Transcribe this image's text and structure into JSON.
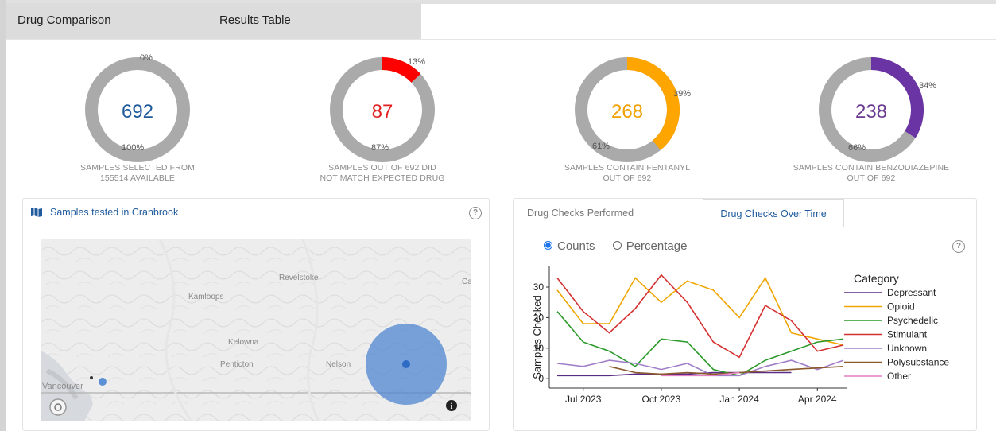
{
  "tabs": {
    "drug_comparison": "Drug Comparison",
    "results_table": "Results Table"
  },
  "donuts": [
    {
      "value": "692",
      "percent": 0,
      "top_label": "0%",
      "bottom_label": "100%",
      "caption1": "SAMPLES SELECTED FROM",
      "caption2": "155514 AVAILABLE",
      "color": "#1f5a9d",
      "slice": "#1f5a9d"
    },
    {
      "value": "87",
      "percent": 13,
      "top_label": "13%",
      "bottom_label": "87%",
      "caption1": "SAMPLES OUT OF 692 DID",
      "caption2": "NOT MATCH EXPECTED DRUG",
      "color": "#e02020",
      "slice": "#ff0000"
    },
    {
      "value": "268",
      "percent": 39,
      "top_label": "39%",
      "bottom_label": "61%",
      "caption1": "SAMPLES CONTAIN FENTANYL",
      "caption2": "OUT OF 692",
      "color": "#f0a000",
      "slice": "#ffa500"
    },
    {
      "value": "238",
      "percent": 34,
      "top_label": "34%",
      "bottom_label": "66%",
      "caption1": "SAMPLES CONTAIN BENZODIAZEPINE",
      "caption2": "OUT OF 692",
      "color": "#6a3a90",
      "slice": "#6a34a4"
    }
  ],
  "map": {
    "title": "Samples tested in Cranbrook",
    "help": "?",
    "info": "i",
    "places": [
      "Revelstoke",
      "Kamloops",
      "Kelowna",
      "Penticton",
      "Nelson",
      "Vancouver",
      "Ca"
    ]
  },
  "chart_panel": {
    "tab_performed": "Drug Checks Performed",
    "tab_over_time": "Drug Checks Over Time",
    "radio_counts": "Counts",
    "radio_percentage": "Percentage",
    "help": "?"
  },
  "chart_data": {
    "type": "line",
    "ylabel": "Samples Checked",
    "xlabel": "",
    "x": [
      "2023-06",
      "2023-07",
      "2023-08",
      "2023-09",
      "2023-10",
      "2023-11",
      "2023-12",
      "2024-01",
      "2024-02",
      "2024-03",
      "2024-04",
      "2024-05"
    ],
    "xticks": [
      {
        "label": "Jul 2023",
        "i": 1
      },
      {
        "label": "Oct 2023",
        "i": 4
      },
      {
        "label": "Jan 2024",
        "i": 7
      },
      {
        "label": "Apr 2024",
        "i": 10
      }
    ],
    "yticks": [
      0,
      10,
      20,
      30
    ],
    "ylim": [
      -1,
      36
    ],
    "legend_title": "Category",
    "series": [
      {
        "name": "Depressant",
        "color": "#5b2c83",
        "values": [
          1,
          1,
          1,
          1.5,
          1.5,
          1.5,
          2,
          2,
          2,
          2,
          null,
          null
        ]
      },
      {
        "name": "Opioid",
        "color": "#f0a500",
        "values": [
          29,
          18,
          18,
          33,
          25,
          32,
          29,
          20,
          33,
          15,
          13,
          11
        ]
      },
      {
        "name": "Psychedelic",
        "color": "#2a9a2a",
        "values": [
          22,
          12,
          9,
          4,
          13,
          12,
          3,
          1,
          6,
          9,
          12,
          13
        ]
      },
      {
        "name": "Stimulant",
        "color": "#d43030",
        "values": [
          33,
          22,
          15,
          23,
          34,
          25,
          12,
          7,
          24,
          19,
          9,
          11
        ]
      },
      {
        "name": "Unknown",
        "color": "#a07fc8",
        "values": [
          5,
          4,
          6,
          5,
          3,
          5,
          1,
          1,
          4,
          6,
          3,
          6
        ]
      },
      {
        "name": "Polysubstance",
        "color": "#8b5a2b",
        "values": [
          null,
          null,
          4,
          2,
          1.5,
          2,
          1.5,
          2,
          2.5,
          3,
          3.5,
          4
        ]
      },
      {
        "name": "Other",
        "color": "#e87fc8",
        "values": [
          null,
          null,
          null,
          null,
          1,
          1,
          1,
          2,
          null,
          null,
          null,
          null
        ]
      }
    ]
  }
}
